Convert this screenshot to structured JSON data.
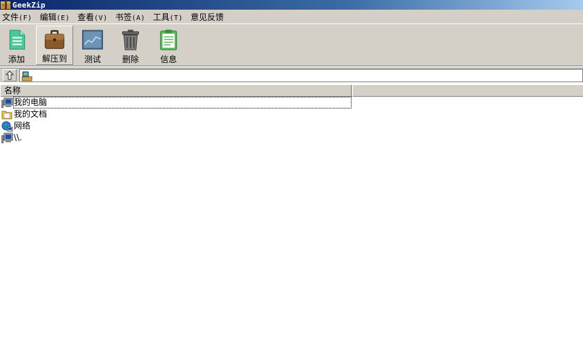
{
  "window": {
    "title": "GeekZip"
  },
  "menu": [
    {
      "label": "文件",
      "accel": "(F)"
    },
    {
      "label": "编辑",
      "accel": "(E)"
    },
    {
      "label": "查看",
      "accel": "(V)"
    },
    {
      "label": "书签",
      "accel": "(A)"
    },
    {
      "label": "工具",
      "accel": "(T)"
    },
    {
      "label": "意见反馈",
      "accel": ""
    }
  ],
  "toolbar": {
    "add": "添加",
    "extract": "解压到",
    "test": "测试",
    "delete": "删除",
    "info": "信息"
  },
  "address": {
    "value": ""
  },
  "columns": {
    "name": "名称"
  },
  "rows": [
    {
      "name": "我的电脑",
      "icon": "computer-icon"
    },
    {
      "name": "我的文档",
      "icon": "folder-icon"
    },
    {
      "name": "网络",
      "icon": "network-icon"
    },
    {
      "name": "\\\\.",
      "icon": "computer-icon"
    }
  ],
  "colors": {
    "title_start": "#0a246a",
    "title_end": "#a6caf0",
    "chrome": "#d4d0c8"
  }
}
